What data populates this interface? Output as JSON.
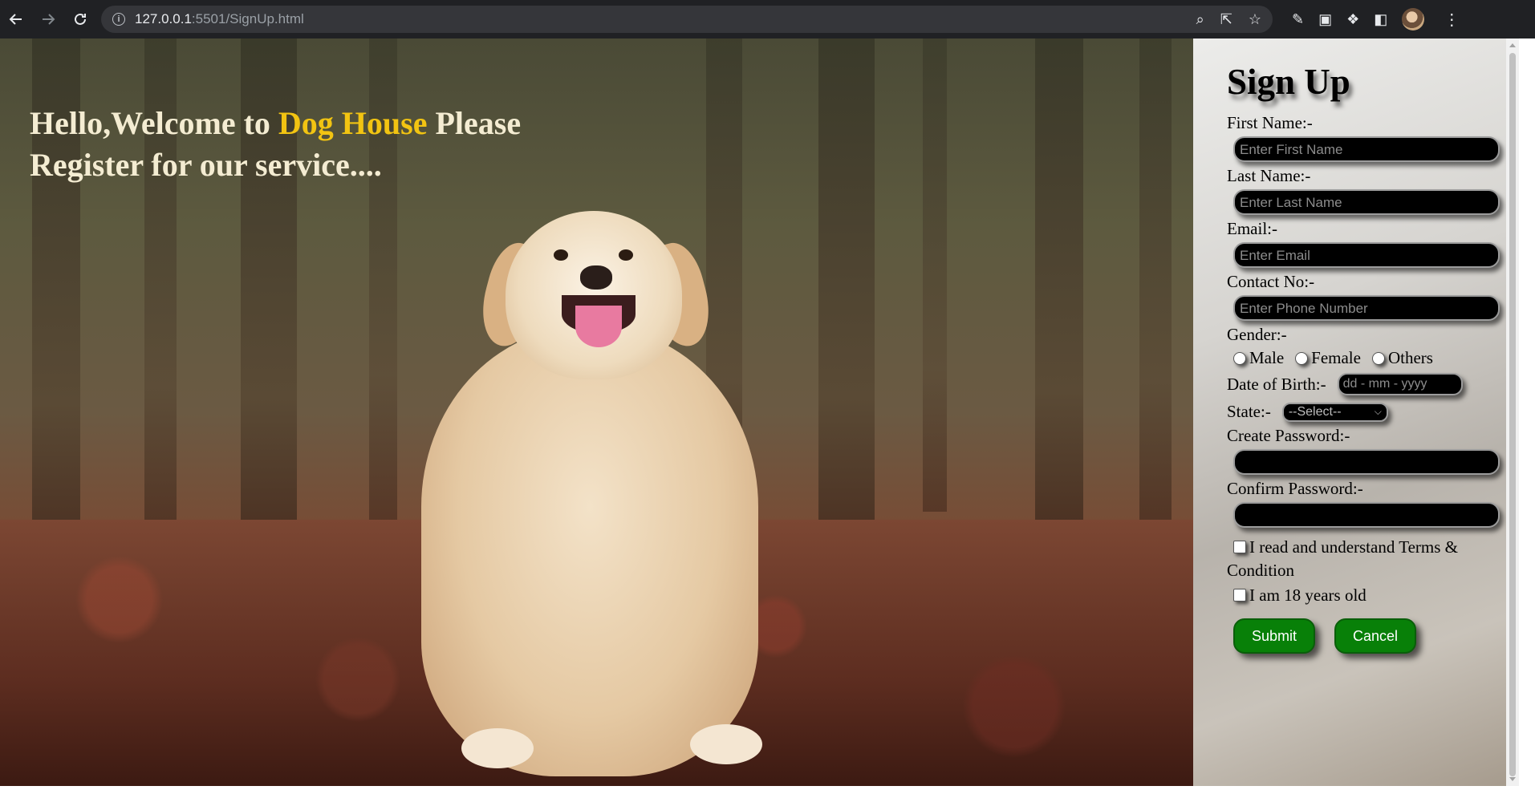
{
  "browser": {
    "url_host": "127.0.0.1",
    "url_path": ":5501/SignUp.html"
  },
  "hero": {
    "welcome_prefix": "Hello,Welcome to ",
    "brand": "Dog House",
    "welcome_suffix": " Please Register for our service....",
    "brand_color": "#f2c412"
  },
  "form": {
    "title": "Sign Up",
    "first_name_label": "First Name:-",
    "first_name_placeholder": "Enter First Name",
    "last_name_label": "Last Name:-",
    "last_name_placeholder": "Enter Last Name",
    "email_label": "Email:-",
    "email_placeholder": "Enter Email",
    "contact_label": "Contact No:-",
    "contact_placeholder": "Enter Phone Number",
    "gender_label": "Gender:-",
    "gender_options": [
      "Male",
      "Female",
      "Others"
    ],
    "dob_label": "Date of Birth:-",
    "dob_placeholder": "dd - mm - yyyy",
    "state_label": "State:-",
    "state_selected": "--Select--",
    "create_password_label": "Create Password:-",
    "confirm_password_label": "Confirm Password:-",
    "terms_text": "I read and understand Terms & Condition",
    "age_text": "I am 18 years old",
    "submit_label": "Submit",
    "cancel_label": "Cancel",
    "button_color": "#088008"
  }
}
